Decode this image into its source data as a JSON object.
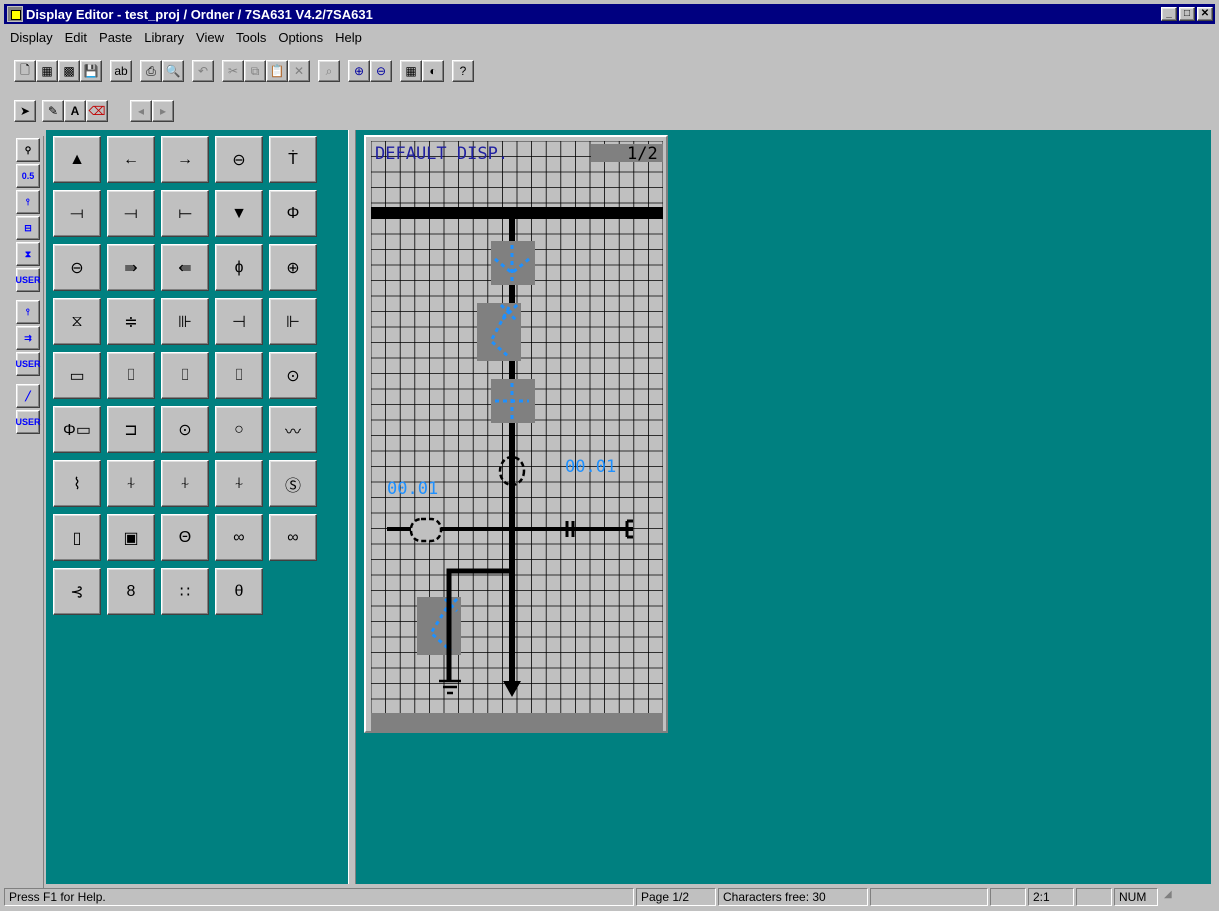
{
  "window": {
    "title": "Display Editor - test_proj / Ordner / 7SA631 V4.2/7SA631"
  },
  "menu": [
    "Display",
    "Edit",
    "Paste",
    "Library",
    "View",
    "Tools",
    "Options",
    "Help"
  ],
  "toolbar1": [
    {
      "name": "new-file-icon",
      "glyph": "🗋"
    },
    {
      "name": "image-icon",
      "glyph": "▦"
    },
    {
      "name": "color-image-icon",
      "glyph": "▩"
    },
    {
      "name": "save-icon",
      "glyph": "💾"
    },
    {
      "name": "spell-check-icon",
      "glyph": "ab"
    },
    {
      "name": "print-icon",
      "glyph": "⎙"
    },
    {
      "name": "print-preview-icon",
      "glyph": "🔍"
    },
    {
      "name": "undo-icon",
      "glyph": "↶"
    },
    {
      "name": "cut-icon",
      "glyph": "✂"
    },
    {
      "name": "copy-icon",
      "glyph": "⧉"
    },
    {
      "name": "paste-icon",
      "glyph": "📋"
    },
    {
      "name": "delete-icon",
      "glyph": "✕"
    },
    {
      "name": "properties-icon",
      "glyph": "⌕"
    },
    {
      "name": "zoom-in-icon",
      "glyph": "⊕"
    },
    {
      "name": "zoom-out-icon",
      "glyph": "⊖"
    },
    {
      "name": "grid-icon",
      "glyph": "▦"
    },
    {
      "name": "contrast-icon",
      "glyph": "◐"
    },
    {
      "name": "help-icon",
      "glyph": "?"
    }
  ],
  "toolbar2": [
    {
      "name": "select-arrow-icon",
      "glyph": "➤"
    },
    {
      "name": "pencil-icon",
      "glyph": "✎"
    },
    {
      "name": "text-icon",
      "glyph": "A"
    },
    {
      "name": "eraser-icon",
      "glyph": "⌫"
    },
    {
      "name": "scroll-left-icon",
      "glyph": "◂"
    },
    {
      "name": "scroll-right-icon",
      "glyph": "▸"
    }
  ],
  "sidebar": [
    {
      "name": "magnifier-icon",
      "glyph": "⚲"
    },
    {
      "name": "measured-value-icon",
      "glyph": "0.5"
    },
    {
      "name": "switch-icon",
      "glyph": "⫯"
    },
    {
      "name": "breaker-icon",
      "glyph": "⊟"
    },
    {
      "name": "hourglass-icon",
      "glyph": "⧗"
    },
    {
      "name": "user-symbol-icon",
      "glyph": "USER"
    },
    {
      "name": "disconnector-icon",
      "glyph": "⫯"
    },
    {
      "name": "feeder-icon",
      "glyph": "⇉"
    },
    {
      "name": "user-library-icon",
      "glyph": "USER"
    },
    {
      "name": "line-icon",
      "glyph": "╱"
    },
    {
      "name": "user-line-icon",
      "glyph": "USER"
    }
  ],
  "palette": [
    [
      "▲",
      "←",
      "→",
      "⊖",
      "Ṫ"
    ],
    [
      "⟞",
      "⟞",
      "⟝",
      "▼",
      "Φ"
    ],
    [
      "⊖",
      "⇛",
      "⇚",
      "ɸ",
      "⊕"
    ],
    [
      "⧖",
      "≑",
      "⊪",
      "⊣",
      "⊩"
    ],
    [
      "▭",
      "⌷",
      "⌷",
      "⌷",
      "⊙"
    ],
    [
      "Φ▭",
      "⊐",
      "⊙",
      "○",
      "〰"
    ],
    [
      "⌇",
      "⍭",
      "⍭",
      "⍭",
      "Ⓢ"
    ],
    [
      "▯",
      "▣",
      "Θ",
      "∞",
      "∞"
    ],
    [
      "⊰",
      "8",
      "∷",
      "θ"
    ]
  ],
  "lcd": {
    "header_left": "DEFAULT DISP.",
    "header_right": "1/2",
    "value_left": "00.01",
    "value_right": "00.01"
  },
  "colors": {
    "lcd_blue": "#1e90ff",
    "lcd_header": "#2020a0",
    "desktop": "#008080"
  },
  "status": {
    "help": "Press F1 for Help.",
    "page": "Page 1/2",
    "chars": "Characters free: 30",
    "ratio": "2:1",
    "num": "NUM"
  }
}
